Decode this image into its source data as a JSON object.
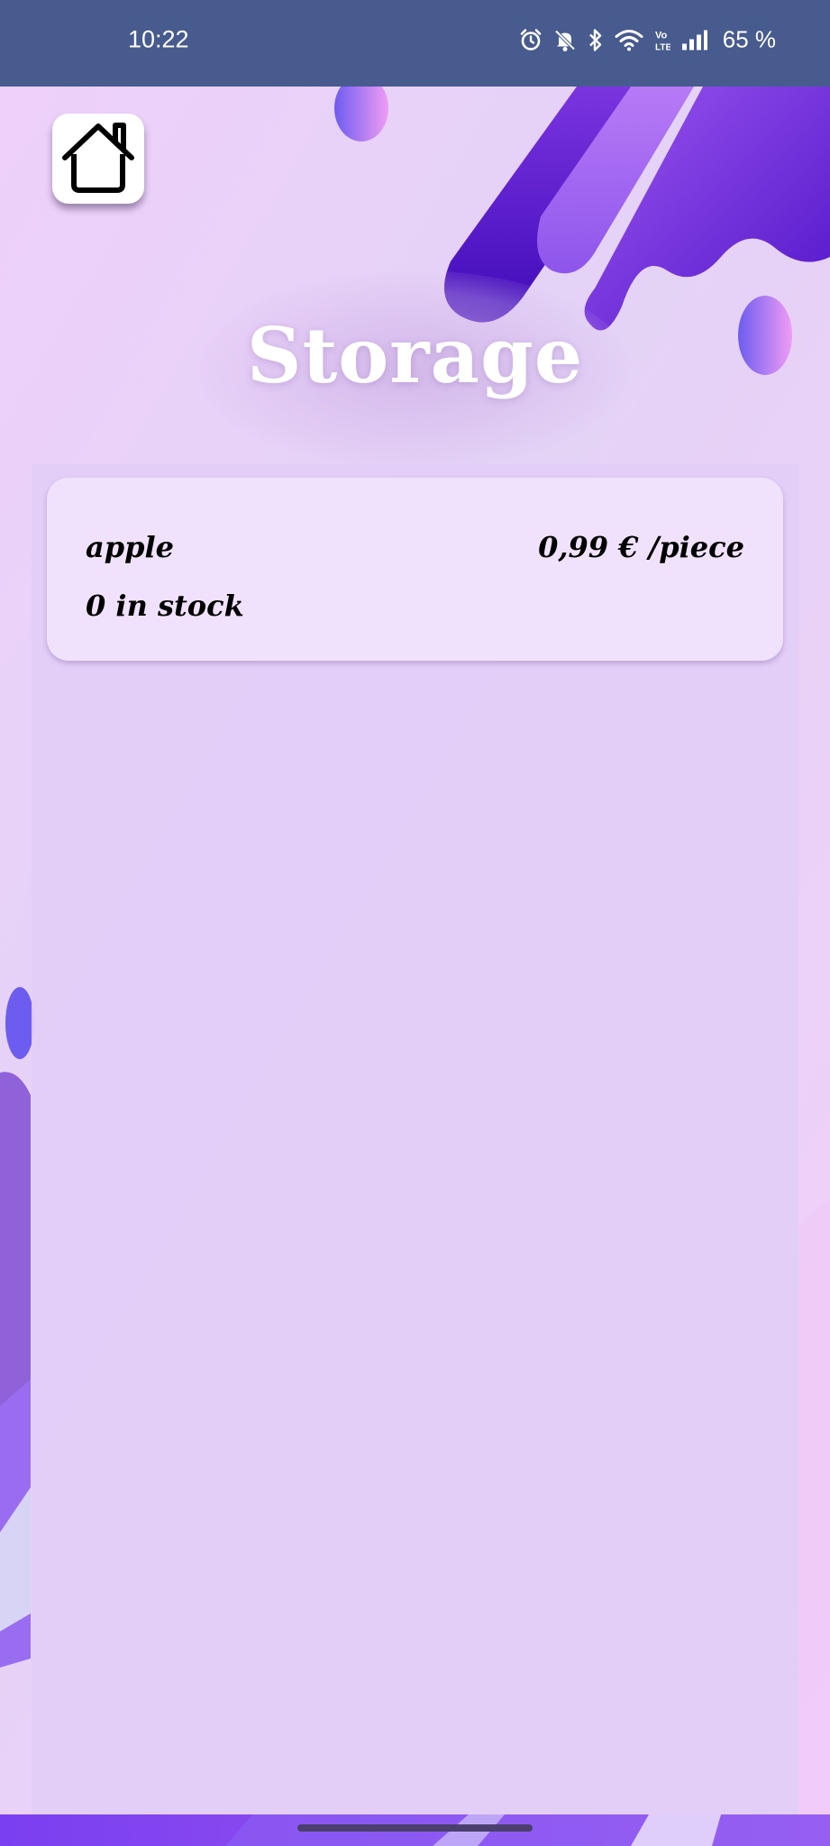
{
  "status_bar": {
    "time": "10:22",
    "battery": "65 %",
    "icons": [
      "alarm-icon",
      "mute-icon",
      "bluetooth-icon",
      "wifi-icon",
      "volte-icon",
      "signal-icon"
    ]
  },
  "header": {
    "home_icon": "home-icon",
    "title": "Storage"
  },
  "items": [
    {
      "name": "apple",
      "price": "0,99 € /piece",
      "stock": "0 in stock"
    }
  ],
  "colors": {
    "status_bar": "#485b8e",
    "panel": "#e2cef8",
    "card": "#f0e2fc",
    "accent_purple": "#7b3fe0",
    "title": "#ffffff"
  }
}
